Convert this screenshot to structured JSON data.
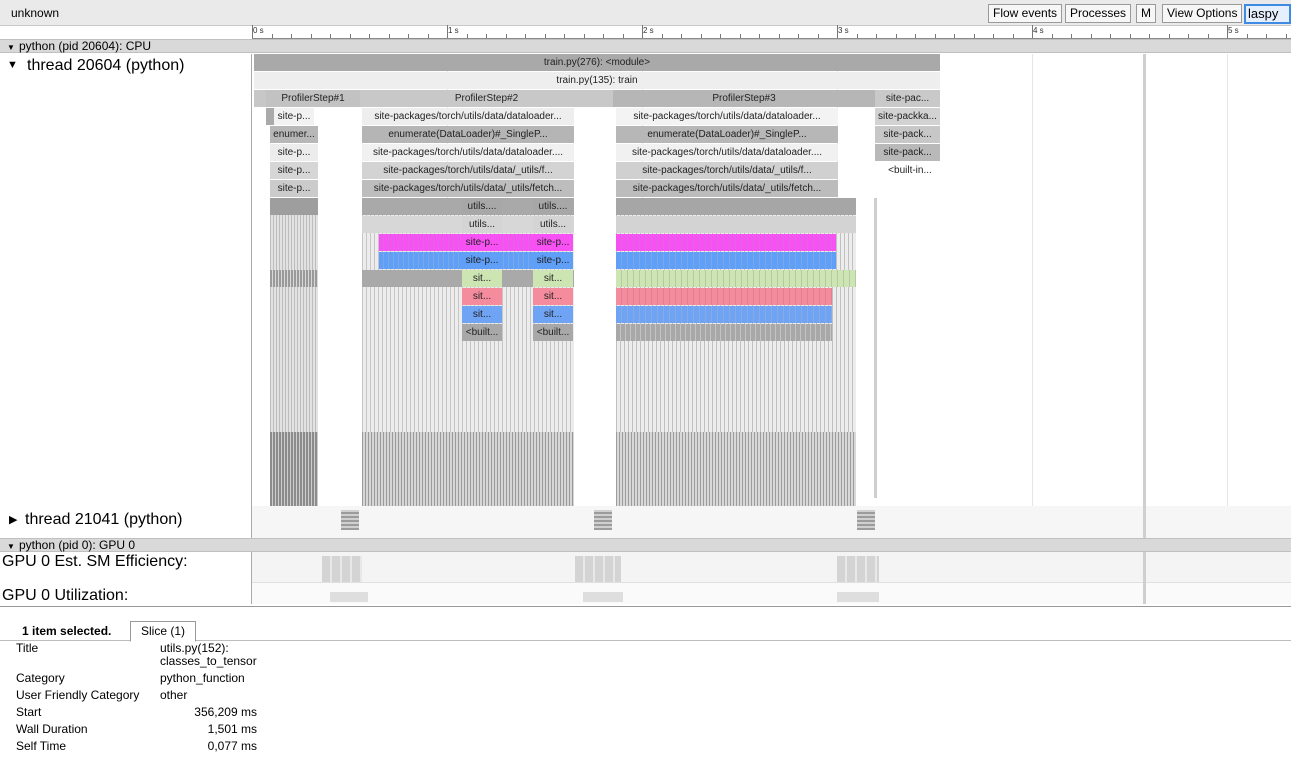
{
  "window": {
    "title": "unknown"
  },
  "toolbar": {
    "flow_events": "Flow events",
    "processes": "Processes",
    "m": "M",
    "view_options": "View Options",
    "search_value": "laspy"
  },
  "ruler": {
    "labels": [
      "0 s",
      "1 s",
      "2 s",
      "3 s",
      "4 s",
      "5 s"
    ]
  },
  "process_cpu": {
    "label": "python (pid 20604): CPU"
  },
  "thread_main": {
    "label": "thread 20604 (python)"
  },
  "thread_other": {
    "label": "thread 21041 (python)"
  },
  "process_gpu": {
    "label": "python (pid 0): GPU 0"
  },
  "gpu_tracks": {
    "sm_efficiency": "GPU 0 Est. SM Efficiency:",
    "utilization": "GPU 0 Utilization:"
  },
  "slices": {
    "module": "train.py(276): <module>",
    "train": "train.py(135): train",
    "step1": "ProfilerStep#1",
    "step2": "ProfilerStep#2",
    "step3": "ProfilerStep#3",
    "step4": "site-pac...",
    "s1_r3": "site-p...",
    "s1_r4": "enumer...",
    "s1_r5": "site-p...",
    "s1_r6": "site-p...",
    "s1_r7": "site-p...",
    "s2_r3": "site-packages/torch/utils/data/dataloader...",
    "s2_r4": "enumerate(DataLoader)#_SingleP...",
    "s2_r5": "site-packages/torch/utils/data/dataloader....",
    "s2_r6": "site-packages/torch/utils/data/_utils/f...",
    "s2_r7": "site-packages/torch/utils/data/_utils/fetch...",
    "s3_r3": "site-packages/torch/utils/data/dataloader...",
    "s3_r4": "enumerate(DataLoader)#_SingleP...",
    "s3_r5": "site-packages/torch/utils/data/dataloader....",
    "s3_r6": "site-packages/torch/utils/data/_utils/f...",
    "s3_r7": "site-packages/torch/utils/data/_utils/fetch...",
    "s4_r3": "site-packka...",
    "s4_r4": "site-pack...",
    "s4_r5": "site-pack...",
    "s4_r6": "<built-in...",
    "a_utils1": "utils....",
    "a_utils2": "utils...",
    "a_sitep1": "site-p...",
    "a_sitep2": "site-p...",
    "a_sit1": "sit...",
    "a_sit2": "sit...",
    "a_sit3": "sit...",
    "a_built": "<built...",
    "b_utils1": "utils....",
    "b_utils2": "utils...",
    "b_sitep1": "site-p...",
    "b_sitep2": "site-p...",
    "b_sit1": "sit...",
    "b_sit2": "sit...",
    "b_sit3": "sit...",
    "b_built": "<built..."
  },
  "colors": {
    "magenta": "#f751f3",
    "blue": "#5f9ff7",
    "green": "#cde5b3",
    "pink": "#f58c9e",
    "blue2": "#6fa4f5",
    "gray": "#a8a8a8",
    "search_border": "#3f8ae2"
  },
  "details": {
    "selection_label": "1 item selected.",
    "tab_label": "Slice (1)",
    "rows": [
      {
        "key": "Title",
        "value": "utils.py(152):",
        "value2": "classes_to_tensor"
      },
      {
        "key": "Category",
        "value": "python_function"
      },
      {
        "key": "User Friendly Category",
        "value": "other"
      },
      {
        "key": "Start",
        "value": "356,209 ms"
      },
      {
        "key": "Wall Duration",
        "value": "1,501 ms"
      },
      {
        "key": "Self Time",
        "value": "0,077 ms"
      }
    ]
  }
}
